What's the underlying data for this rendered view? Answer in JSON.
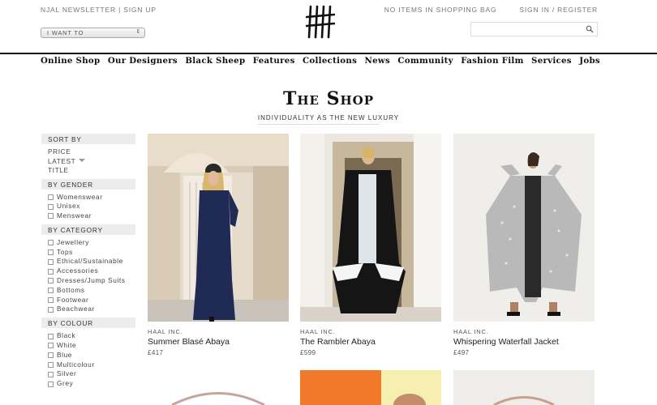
{
  "header": {
    "newsletter": "NJAL NEWSLETTER",
    "separator": " | ",
    "signup": "SIGN UP",
    "bag": "NO ITEMS IN SHOPPING BAG",
    "account": "SIGN IN / REGISTER",
    "i_want_to": "I WANT TO",
    "search_placeholder": ""
  },
  "nav": [
    "Online Shop",
    "Our Designers",
    "Black Sheep",
    "Features",
    "Collections",
    "News",
    "Community",
    "Fashion Film",
    "Services",
    "Jobs"
  ],
  "page": {
    "title": "The Shop",
    "subtitle": "INDIVIDUALITY AS THE NEW LUXURY"
  },
  "sidebar": {
    "sort": {
      "title": "SORT BY",
      "items": [
        "PRICE",
        "LATEST",
        "TITLE"
      ]
    },
    "gender": {
      "title": "BY GENDER",
      "items": [
        "Womenswear",
        "Unisex",
        "Menswear"
      ]
    },
    "category": {
      "title": "BY CATEGORY",
      "items": [
        "Jewellery",
        "Tops",
        "Ethical/Sustainable",
        "Accessories",
        "Dresses/Jump Suits",
        "Bottoms",
        "Footwear",
        "Beachwear"
      ]
    },
    "colour": {
      "title": "BY COLOUR",
      "items": [
        "Black",
        "White",
        "Blue",
        "Multicolour",
        "Silver",
        "Grey"
      ]
    }
  },
  "products": [
    {
      "brand": "HAAL INC.",
      "name": "Summer Blasé Abaya",
      "price": "£417"
    },
    {
      "brand": "HAAL INC.",
      "name": "The Rambler Abaya",
      "price": "£599"
    },
    {
      "brand": "HAAL INC.",
      "name": "Whispering Waterfall Jacket",
      "price": "£497"
    }
  ],
  "colors": {
    "rule": "#111111",
    "sidebar_header": "#ececec",
    "accent_orange": "#f07a2a"
  }
}
